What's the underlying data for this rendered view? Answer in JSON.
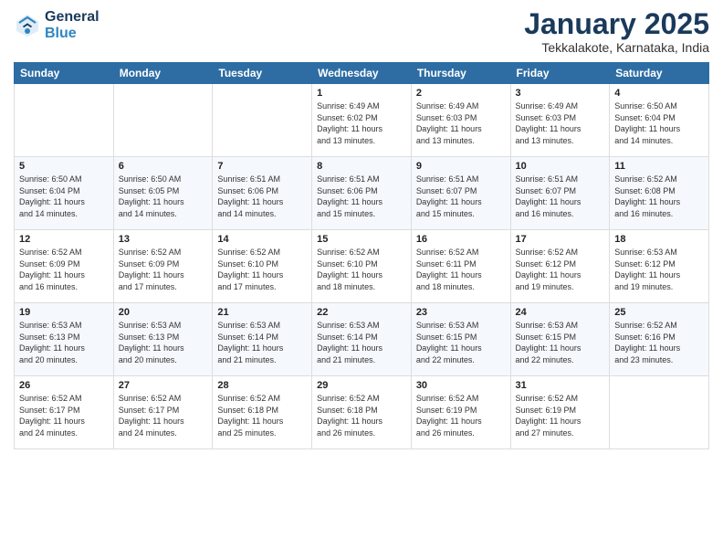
{
  "header": {
    "logo_line1": "General",
    "logo_line2": "Blue",
    "month": "January 2025",
    "location": "Tekkalakote, Karnataka, India"
  },
  "weekdays": [
    "Sunday",
    "Monday",
    "Tuesday",
    "Wednesday",
    "Thursday",
    "Friday",
    "Saturday"
  ],
  "weeks": [
    [
      {
        "day": "",
        "info": ""
      },
      {
        "day": "",
        "info": ""
      },
      {
        "day": "",
        "info": ""
      },
      {
        "day": "1",
        "info": "Sunrise: 6:49 AM\nSunset: 6:02 PM\nDaylight: 11 hours\nand 13 minutes."
      },
      {
        "day": "2",
        "info": "Sunrise: 6:49 AM\nSunset: 6:03 PM\nDaylight: 11 hours\nand 13 minutes."
      },
      {
        "day": "3",
        "info": "Sunrise: 6:49 AM\nSunset: 6:03 PM\nDaylight: 11 hours\nand 13 minutes."
      },
      {
        "day": "4",
        "info": "Sunrise: 6:50 AM\nSunset: 6:04 PM\nDaylight: 11 hours\nand 14 minutes."
      }
    ],
    [
      {
        "day": "5",
        "info": "Sunrise: 6:50 AM\nSunset: 6:04 PM\nDaylight: 11 hours\nand 14 minutes."
      },
      {
        "day": "6",
        "info": "Sunrise: 6:50 AM\nSunset: 6:05 PM\nDaylight: 11 hours\nand 14 minutes."
      },
      {
        "day": "7",
        "info": "Sunrise: 6:51 AM\nSunset: 6:06 PM\nDaylight: 11 hours\nand 14 minutes."
      },
      {
        "day": "8",
        "info": "Sunrise: 6:51 AM\nSunset: 6:06 PM\nDaylight: 11 hours\nand 15 minutes."
      },
      {
        "day": "9",
        "info": "Sunrise: 6:51 AM\nSunset: 6:07 PM\nDaylight: 11 hours\nand 15 minutes."
      },
      {
        "day": "10",
        "info": "Sunrise: 6:51 AM\nSunset: 6:07 PM\nDaylight: 11 hours\nand 16 minutes."
      },
      {
        "day": "11",
        "info": "Sunrise: 6:52 AM\nSunset: 6:08 PM\nDaylight: 11 hours\nand 16 minutes."
      }
    ],
    [
      {
        "day": "12",
        "info": "Sunrise: 6:52 AM\nSunset: 6:09 PM\nDaylight: 11 hours\nand 16 minutes."
      },
      {
        "day": "13",
        "info": "Sunrise: 6:52 AM\nSunset: 6:09 PM\nDaylight: 11 hours\nand 17 minutes."
      },
      {
        "day": "14",
        "info": "Sunrise: 6:52 AM\nSunset: 6:10 PM\nDaylight: 11 hours\nand 17 minutes."
      },
      {
        "day": "15",
        "info": "Sunrise: 6:52 AM\nSunset: 6:10 PM\nDaylight: 11 hours\nand 18 minutes."
      },
      {
        "day": "16",
        "info": "Sunrise: 6:52 AM\nSunset: 6:11 PM\nDaylight: 11 hours\nand 18 minutes."
      },
      {
        "day": "17",
        "info": "Sunrise: 6:52 AM\nSunset: 6:12 PM\nDaylight: 11 hours\nand 19 minutes."
      },
      {
        "day": "18",
        "info": "Sunrise: 6:53 AM\nSunset: 6:12 PM\nDaylight: 11 hours\nand 19 minutes."
      }
    ],
    [
      {
        "day": "19",
        "info": "Sunrise: 6:53 AM\nSunset: 6:13 PM\nDaylight: 11 hours\nand 20 minutes."
      },
      {
        "day": "20",
        "info": "Sunrise: 6:53 AM\nSunset: 6:13 PM\nDaylight: 11 hours\nand 20 minutes."
      },
      {
        "day": "21",
        "info": "Sunrise: 6:53 AM\nSunset: 6:14 PM\nDaylight: 11 hours\nand 21 minutes."
      },
      {
        "day": "22",
        "info": "Sunrise: 6:53 AM\nSunset: 6:14 PM\nDaylight: 11 hours\nand 21 minutes."
      },
      {
        "day": "23",
        "info": "Sunrise: 6:53 AM\nSunset: 6:15 PM\nDaylight: 11 hours\nand 22 minutes."
      },
      {
        "day": "24",
        "info": "Sunrise: 6:53 AM\nSunset: 6:15 PM\nDaylight: 11 hours\nand 22 minutes."
      },
      {
        "day": "25",
        "info": "Sunrise: 6:52 AM\nSunset: 6:16 PM\nDaylight: 11 hours\nand 23 minutes."
      }
    ],
    [
      {
        "day": "26",
        "info": "Sunrise: 6:52 AM\nSunset: 6:17 PM\nDaylight: 11 hours\nand 24 minutes."
      },
      {
        "day": "27",
        "info": "Sunrise: 6:52 AM\nSunset: 6:17 PM\nDaylight: 11 hours\nand 24 minutes."
      },
      {
        "day": "28",
        "info": "Sunrise: 6:52 AM\nSunset: 6:18 PM\nDaylight: 11 hours\nand 25 minutes."
      },
      {
        "day": "29",
        "info": "Sunrise: 6:52 AM\nSunset: 6:18 PM\nDaylight: 11 hours\nand 26 minutes."
      },
      {
        "day": "30",
        "info": "Sunrise: 6:52 AM\nSunset: 6:19 PM\nDaylight: 11 hours\nand 26 minutes."
      },
      {
        "day": "31",
        "info": "Sunrise: 6:52 AM\nSunset: 6:19 PM\nDaylight: 11 hours\nand 27 minutes."
      },
      {
        "day": "",
        "info": ""
      }
    ]
  ]
}
